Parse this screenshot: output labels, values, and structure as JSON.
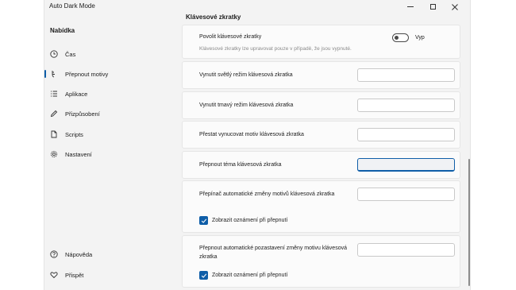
{
  "window": {
    "title": "Auto Dark Mode"
  },
  "sidebar": {
    "title": "Nabídka",
    "items": [
      {
        "label": "Čas",
        "icon": "clock-icon"
      },
      {
        "label": "Přepnout motivy",
        "icon": "brush-icon",
        "active": true
      },
      {
        "label": "Aplikace",
        "icon": "list-icon"
      },
      {
        "label": "Přizpůsobení",
        "icon": "pen-icon"
      },
      {
        "label": "Scripts",
        "icon": "document-icon"
      },
      {
        "label": "Nastavení",
        "icon": "gear-icon"
      }
    ],
    "bottom_items": [
      {
        "label": "Nápověda",
        "icon": "help-icon"
      },
      {
        "label": "Přispět",
        "icon": "heart-icon"
      }
    ]
  },
  "content": {
    "heading": "Klávesové zkratky",
    "enable": {
      "label": "Povolit klávesové zkratky",
      "description": "Klávesové zkratky lze upravovat pouze v případě, že jsou vypnuté.",
      "state": "Vyp"
    },
    "shortcuts": [
      {
        "label": "Vynutit světlý režim klávesová zkratka",
        "value": ""
      },
      {
        "label": "Vynutit tmavý režim klávesová zkratka",
        "value": ""
      },
      {
        "label": "Přestat vynucovat motiv klávesová zkratka",
        "value": ""
      },
      {
        "label": "Přepnout téma klávesová zkratka",
        "value": ""
      },
      {
        "label": "Přepínač automatické změny motivů klávesová zkratka",
        "value": ""
      },
      {
        "label": "Přepnout automatické pozastavení změny motivu klávesová zkratka",
        "value": ""
      }
    ],
    "notify_label_1": "Zobrazit oznámení při přepnutí",
    "notify_label_2": "Zobrazit oznámení při přepnutí"
  },
  "colors": {
    "accent": "#0f5ea8",
    "background": "#f3f3f3",
    "card": "#fbfbfb"
  }
}
